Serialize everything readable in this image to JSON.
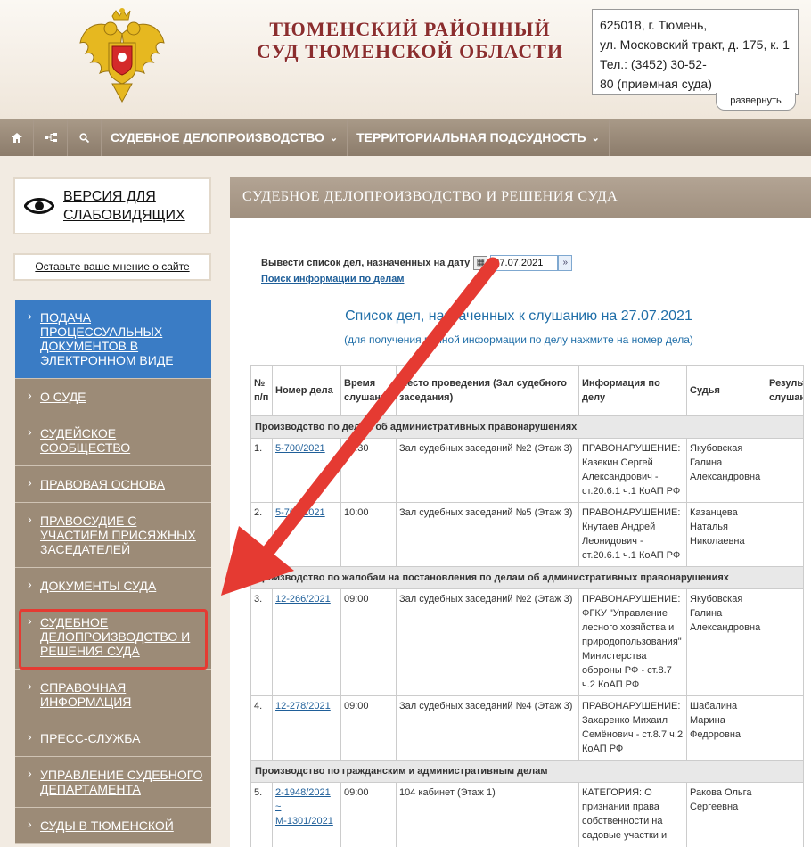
{
  "header": {
    "court_name": "ТЮМЕНСКИЙ РАЙОННЫЙ СУД ТЮМЕНСКОЙ ОБЛАСТИ",
    "address_lines": [
      "625018, г. Тюмень,",
      "ул. Московский тракт, д. 175, к. 1",
      "Тел.: (3452) 30-52-",
      "80 (приемная суда)"
    ],
    "expand_label": "развернуть"
  },
  "topnav": {
    "icons": [
      "home-icon",
      "sitemap-icon",
      "search-icon"
    ],
    "items": [
      {
        "label": "СУДЕБНОЕ ДЕЛОПРОИЗВОДСТВО"
      },
      {
        "label": "ТЕРРИТОРИАЛЬНАЯ ПОДСУДНОСТЬ"
      }
    ]
  },
  "sidebar": {
    "vision_label": "ВЕРСИЯ ДЛЯ СЛАБОВИДЯЩИХ",
    "opinion_label": "Оставьте ваше мнение о сайте",
    "items": [
      {
        "label": "ПОДАЧА ПРОЦЕССУАЛЬНЫХ ДОКУМЕНТОВ В ЭЛЕКТРОННОМ ВИДЕ"
      },
      {
        "label": "О СУДЕ"
      },
      {
        "label": "СУДЕЙСКОЕ СООБЩЕСТВО"
      },
      {
        "label": "ПРАВОВАЯ ОСНОВА"
      },
      {
        "label": "ПРАВОСУДИЕ С УЧАСТИЕМ ПРИСЯЖНЫХ ЗАСЕДАТЕЛЕЙ"
      },
      {
        "label": "ДОКУМЕНТЫ СУДА"
      },
      {
        "label": "СУДЕБНОЕ ДЕЛОПРОИЗВОДСТВО И РЕШЕНИЯ СУДА"
      },
      {
        "label": "СПРАВОЧНАЯ ИНФОРМАЦИЯ"
      },
      {
        "label": "ПРЕСС-СЛУЖБА"
      },
      {
        "label": "УПРАВЛЕНИЕ СУДЕБНОГО ДЕПАРТАМЕНТА"
      },
      {
        "label": "СУДЫ В ТЮМЕНСКОЙ"
      }
    ]
  },
  "main": {
    "heading": "СУДЕБНОЕ ДЕЛОПРОИЗВОДСТВО И РЕШЕНИЯ СУДА",
    "date_label": "Вывести список дел, назначенных на дату",
    "date_value": "27.07.2021",
    "search_link": "Поиск информации по делам",
    "list_title": "Список дел, назначенных к слушанию на 27.07.2021",
    "list_subtitle": "(для получения полной информации по делу нажмите на номер дела)",
    "columns": [
      "№ п/п",
      "Номер дела",
      "Время слушания",
      "Место проведения (Зал судебного заседания)",
      "Информация по делу",
      "Судья",
      "Результат слушания"
    ],
    "sections": [
      {
        "title": "Производство по делам об административных правонарушениях",
        "rows": [
          {
            "n": "1.",
            "case": "5-700/2021",
            "time": "10:30",
            "place": "Зал судебных заседаний №2 (Этаж 3)",
            "info": "ПРАВОНАРУШЕНИЕ: Казекин Сергей Александрович - ст.20.6.1 ч.1 КоАП РФ",
            "judge": "Якубовская Галина Александровна"
          },
          {
            "n": "2.",
            "case": "5-701/2021",
            "time": "10:00",
            "place": "Зал судебных заседаний №5 (Этаж 3)",
            "info": "ПРАВОНАРУШЕНИЕ: Кнутаев Андрей Леонидович - ст.20.6.1 ч.1 КоАП РФ",
            "judge": "Казанцева Наталья Николаевна"
          }
        ]
      },
      {
        "title": "Производство по жалобам на постановления по делам об административных правонарушениях",
        "rows": [
          {
            "n": "3.",
            "case": "12-266/2021",
            "time": "09:00",
            "place": "Зал судебных заседаний №2 (Этаж 3)",
            "info": "ПРАВОНАРУШЕНИЕ: ФГКУ \"Управление лесного хозяйства и природопользования\" Министерства обороны РФ - ст.8.7 ч.2 КоАП РФ",
            "judge": "Якубовская Галина Александровна"
          },
          {
            "n": "4.",
            "case": "12-278/2021",
            "time": "09:00",
            "place": "Зал судебных заседаний №4 (Этаж 3)",
            "info": "ПРАВОНАРУШЕНИЕ: Захаренко Михаил Семёнович - ст.8.7 ч.2 КоАП РФ",
            "judge": "Шабалина Марина Федоровна"
          }
        ]
      },
      {
        "title": "Производство по гражданским и административным делам",
        "rows": [
          {
            "n": "5.",
            "case": "2-1948/2021 ~ М-1301/2021",
            "time": "09:00",
            "place": "104 кабинет (Этаж 1)",
            "info": "КАТЕГОРИЯ: О признании права собственности на садовые участки и",
            "judge": "Ракова Ольга Сергеевна"
          }
        ]
      }
    ]
  },
  "colors": {
    "nav_bg": "#9c8b77",
    "active_item": "#3a7cc5",
    "court_name": "#8b2e2e",
    "link": "#1f5f99",
    "annotation": "#e53a32"
  }
}
